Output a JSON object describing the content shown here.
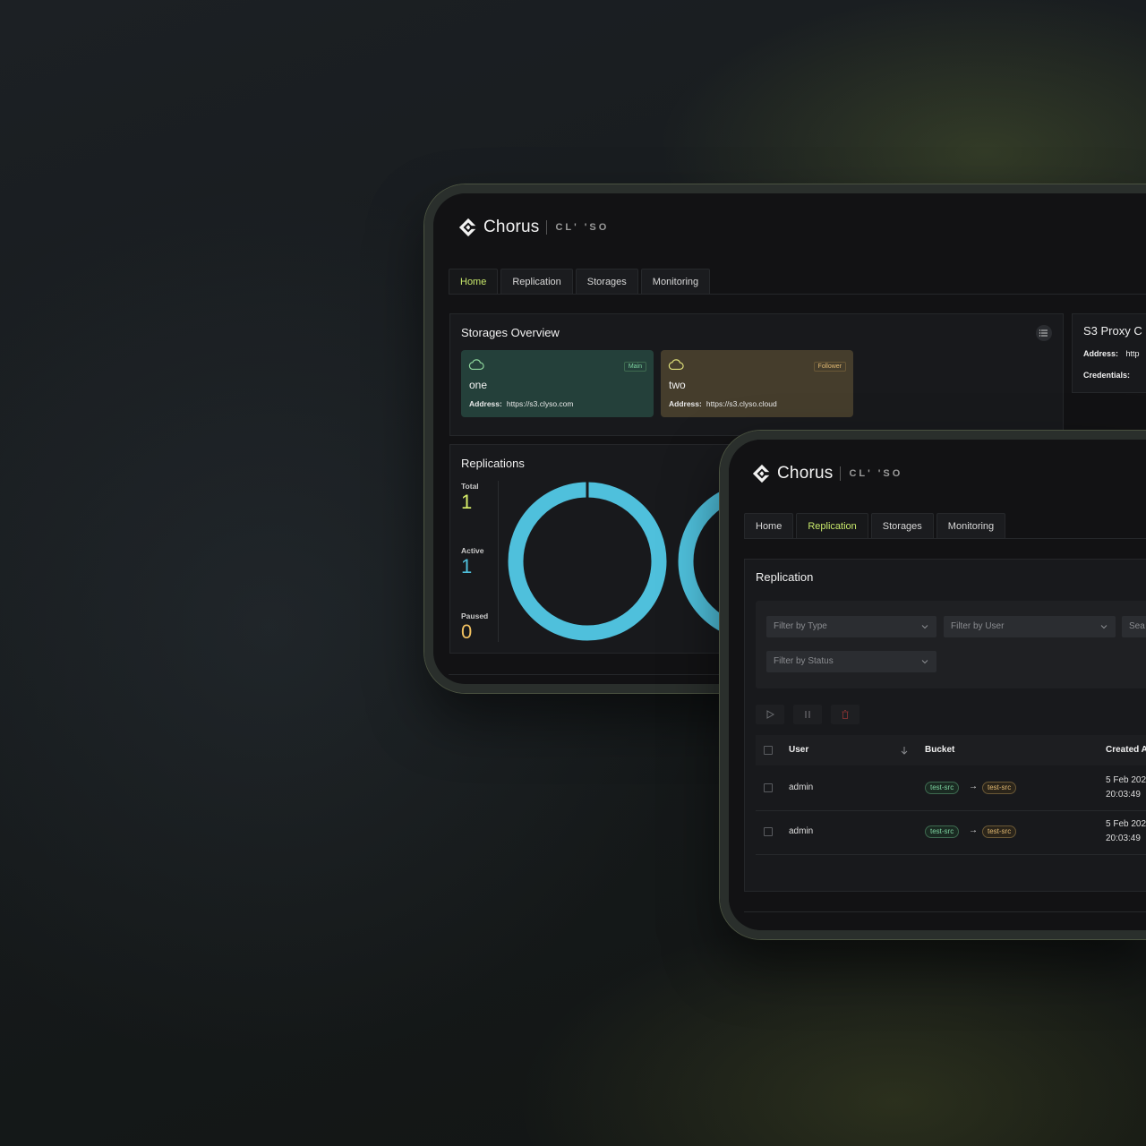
{
  "back_screen": {
    "brand": {
      "name": "Chorus",
      "partner": "CL' 'SO"
    },
    "tabs": [
      {
        "label": "Home",
        "active": true
      },
      {
        "label": "Replication",
        "active": false
      },
      {
        "label": "Storages",
        "active": false
      },
      {
        "label": "Monitoring",
        "active": false
      }
    ],
    "storages_overview": {
      "title": "Storages Overview",
      "address_label": "Address:",
      "cards": [
        {
          "name": "one",
          "badge": "Main",
          "address": "https://s3.clyso.com",
          "color": "#24403a"
        },
        {
          "name": "two",
          "badge": "Follower",
          "address": "https://s3.clyso.cloud",
          "color": "#453d2c"
        }
      ]
    },
    "s3_proxy": {
      "title": "S3 Proxy C",
      "address_label": "Address:",
      "address_value": "http",
      "credentials_label": "Credentials:"
    },
    "replications": {
      "title": "Replications",
      "total_label": "Total",
      "total_value": "1",
      "active_label": "Active",
      "active_value": "1",
      "paused_label": "Paused",
      "paused_value": "0",
      "ring_color": "#4fc0dc"
    }
  },
  "front_screen": {
    "brand": {
      "name": "Chorus",
      "partner": "CL' 'SO"
    },
    "tabs": [
      {
        "label": "Home",
        "active": false
      },
      {
        "label": "Replication",
        "active": true
      },
      {
        "label": "Storages",
        "active": false
      },
      {
        "label": "Monitoring",
        "active": false
      }
    ],
    "replication_panel": {
      "title": "Replication",
      "filters": {
        "type_placeholder": "Filter by Type",
        "user_placeholder": "Filter by User",
        "search_placeholder": "Sea",
        "status_placeholder": "Filter by Status"
      },
      "table": {
        "headers": {
          "user": "User",
          "bucket": "Bucket",
          "created": "Created A"
        },
        "rows": [
          {
            "user": "admin",
            "from_bucket": "test-src",
            "to_bucket": "test-src",
            "date": "5 Feb 202",
            "time": "20:03:49"
          },
          {
            "user": "admin",
            "from_bucket": "test-src",
            "to_bucket": "test-src",
            "date": "5 Feb 202",
            "time": "20:03:49"
          }
        ]
      }
    }
  },
  "colors": {
    "accent_green": "#c8e86b",
    "stat_total": "#d8ef6a",
    "stat_active": "#4fc0dc",
    "stat_paused": "#f0c060"
  }
}
